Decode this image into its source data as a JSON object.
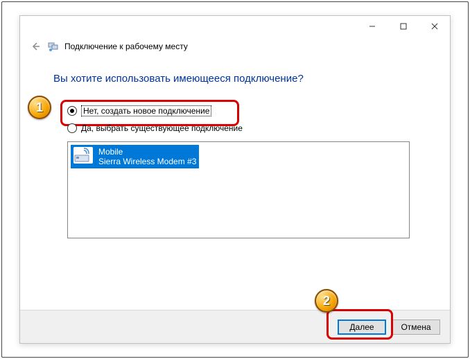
{
  "window": {
    "title": "Подключение к рабочему месту"
  },
  "question": "Вы хотите использовать имеющееся подключение?",
  "options": {
    "new": "Нет, создать новое подключение",
    "existing": "Да, выбрать существующее подключение"
  },
  "connection": {
    "name": "Mobile",
    "detail": "Sierra Wireless Modem #3"
  },
  "buttons": {
    "next": "Далее",
    "cancel": "Отмена"
  },
  "annotations": {
    "step1": "1",
    "step2": "2"
  }
}
